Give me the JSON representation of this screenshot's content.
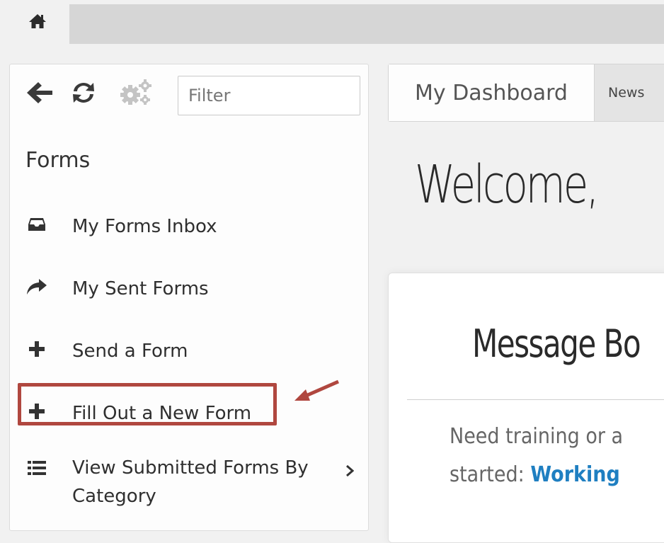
{
  "topbar": {
    "home_icon": "home-icon"
  },
  "sidebar": {
    "toolbar": {
      "back_icon": "arrow-left-icon",
      "refresh_icon": "refresh-icon",
      "settings_icon": "gears-icon",
      "filter_placeholder": "Filter",
      "filter_value": ""
    },
    "section_title": "Forms",
    "items": [
      {
        "label": "My Forms Inbox",
        "icon": "inbox-icon"
      },
      {
        "label": "My Sent Forms",
        "icon": "share-arrow-icon"
      },
      {
        "label": "Send a Form",
        "icon": "plus-icon"
      },
      {
        "label": "Fill Out a New Form",
        "icon": "plus-icon",
        "highlighted": true
      },
      {
        "label_line1": "View Submitted Forms By",
        "label_line2": "Category",
        "icon": "list-icon",
        "has_submenu": true
      }
    ]
  },
  "tabs": {
    "active": "My Dashboard",
    "other": "News"
  },
  "main": {
    "welcome": "Welcome,",
    "message_board": {
      "title": "Message Bo",
      "line1": "Need training or a",
      "line2_prefix": "started: ",
      "line2_link": "Working"
    }
  },
  "colors": {
    "highlight": "#b0473f",
    "link": "#1f7fc1",
    "topbar": "#d6d6d6"
  }
}
